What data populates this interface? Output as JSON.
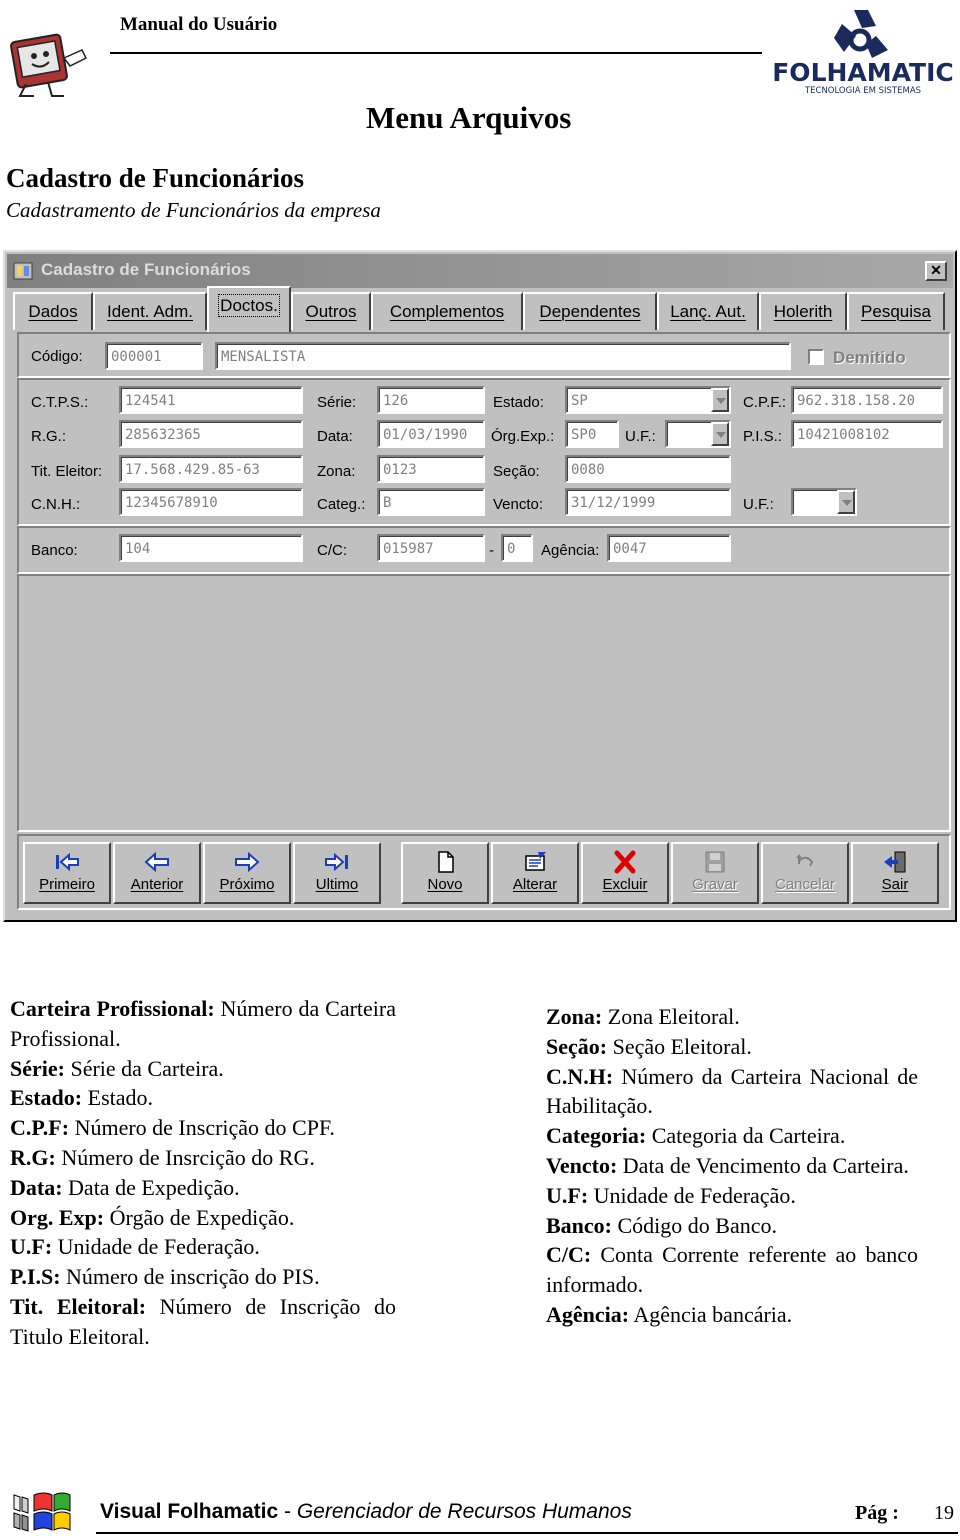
{
  "header": {
    "title": "Manual do Usuário",
    "logo_text": "FOLHAMATIC",
    "logo_tagline": "TECNOLOGIA EM SISTEMAS",
    "section": "Menu Arquivos"
  },
  "page": {
    "title": "Cadastro de Funcionários",
    "subtitle": "Cadastramento de Funcionários da empresa"
  },
  "window": {
    "title": "Cadastro de Funcionários",
    "close_glyph": "✕",
    "tabs": [
      "Dados",
      "Ident. Adm.",
      "Doctos.",
      "Outros",
      "Complementos",
      "Dependentes",
      "Lanç. Aut.",
      "Holerith",
      "Pesquisa"
    ],
    "active_tab": "Doctos.",
    "codigo": {
      "label": "Código:",
      "value": "000001",
      "tipo": "MENSALISTA"
    },
    "demitido": {
      "label": "Demitido",
      "checked": false
    },
    "fields": {
      "ctps": {
        "label": "C.T.P.S.:",
        "value": "124541"
      },
      "serie": {
        "label": "Série:",
        "value": "126"
      },
      "estado": {
        "label": "Estado:",
        "value": "SP"
      },
      "cpf": {
        "label": "C.P.F.:",
        "value": "962.318.158.20"
      },
      "rg": {
        "label": "R.G.:",
        "value": "285632365"
      },
      "data": {
        "label": "Data:",
        "value": "01/03/1990"
      },
      "org_exp": {
        "label": "Órg.Exp.:",
        "value": "SP0"
      },
      "uf_rg": {
        "label": "U.F.:",
        "value": ""
      },
      "pis": {
        "label": "P.I.S.:",
        "value": "10421008102"
      },
      "tit_eleitor": {
        "label": "Tit. Eleitor:",
        "value": "17.568.429.85-63"
      },
      "zona": {
        "label": "Zona:",
        "value": "0123"
      },
      "secao": {
        "label": "Seção:",
        "value": "0080"
      },
      "cnh": {
        "label": "C.N.H.:",
        "value": "12345678910"
      },
      "categ": {
        "label": "Categ.:",
        "value": "B"
      },
      "vencto": {
        "label": "Vencto:",
        "value": "31/12/1999"
      },
      "uf_cnh": {
        "label": "U.F.:",
        "value": ""
      },
      "banco": {
        "label": "Banco:",
        "value": "104"
      },
      "cc": {
        "label": "C/C:",
        "value": "015987",
        "dash": "-",
        "digit": "0"
      },
      "agencia": {
        "label": "Agência:",
        "value": "0047"
      }
    },
    "buttons": [
      {
        "label": "Primeiro",
        "icon": "first-record-icon",
        "enabled": true
      },
      {
        "label": "Anterior",
        "icon": "previous-arrow-icon",
        "enabled": true
      },
      {
        "label": "Próximo",
        "icon": "next-arrow-icon",
        "enabled": true
      },
      {
        "label": "Ultimo",
        "icon": "last-record-icon",
        "enabled": true
      },
      {
        "label": "Novo",
        "icon": "new-document-icon",
        "enabled": true
      },
      {
        "label": "Alterar",
        "icon": "edit-icon",
        "enabled": true
      },
      {
        "label": "Excluir",
        "icon": "delete-x-icon",
        "enabled": true
      },
      {
        "label": "Gravar",
        "icon": "save-disk-icon",
        "enabled": false
      },
      {
        "label": "Cancelar",
        "icon": "undo-icon",
        "enabled": false
      },
      {
        "label": "Sair",
        "icon": "exit-door-icon",
        "enabled": true
      }
    ]
  },
  "descriptions": {
    "left": [
      {
        "term": "Carteira Profissional:",
        "text": " Número da Carteira Profissional."
      },
      {
        "term": "Série:",
        "text": " Série da Carteira."
      },
      {
        "term": "Estado:",
        "text": " Estado."
      },
      {
        "term": "C.P.F:",
        "text": " Número de Inscrição do CPF."
      },
      {
        "term": "R.G:",
        "text": " Número de Insrcição do RG."
      },
      {
        "term": "Data:",
        "text": " Data de Expedição."
      },
      {
        "term": "Org. Exp:",
        "text": " Órgão de Expedição."
      },
      {
        "term": "U.F:",
        "text": " Unidade de Federação."
      },
      {
        "term": "P.I.S:",
        "text": " Número de inscrição do PIS."
      },
      {
        "term": "Tit. Eleitoral:",
        "text": " Número de Inscrição do Titulo Eleitoral."
      }
    ],
    "right": [
      {
        "term": "Zona:",
        "text": " Zona Eleitoral."
      },
      {
        "term": "Seção:",
        "text": " Seção Eleitoral."
      },
      {
        "term": "C.N.H:",
        "text": " Número da Carteira Nacional de Habilitação."
      },
      {
        "term": "Categoria:",
        "text": " Categoria da Carteira."
      },
      {
        "term": "Vencto:",
        "text": " Data de Vencimento da Carteira."
      },
      {
        "term": "U.F:",
        "text": " Unidade de Federação."
      },
      {
        "term": "Banco:",
        "text": " Código do Banco."
      },
      {
        "term": "C/C:",
        "text": " Conta Corrente referente ao banco informado."
      },
      {
        "term": "Agência:",
        "text": " Agência bancária."
      }
    ]
  },
  "footer": {
    "product": "Visual Folhamatic",
    "separator": " - ",
    "subtitle": "Gerenciador de Recursos Humanos",
    "page_label": "Pág :",
    "page_number": "19"
  }
}
